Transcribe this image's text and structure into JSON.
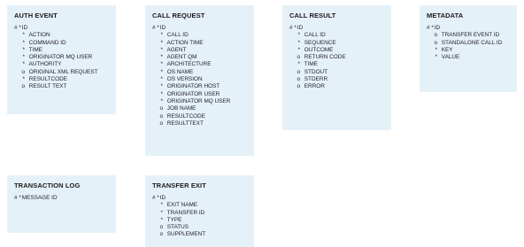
{
  "entities": [
    {
      "key": "auth-event",
      "title": "AUTH EVENT",
      "attributes": [
        {
          "marker": "# *",
          "name": "ID",
          "pk": true
        },
        {
          "marker": "*",
          "name": "ACTION"
        },
        {
          "marker": "*",
          "name": "COMMAND ID"
        },
        {
          "marker": "*",
          "name": "TIME"
        },
        {
          "marker": "*",
          "name": "ORIGINATOR MQ USER"
        },
        {
          "marker": "*",
          "name": "AUTHORITY"
        },
        {
          "marker": "o",
          "name": "ORIGINAL XML REQUEST"
        },
        {
          "marker": "*",
          "name": "RESULTCODE"
        },
        {
          "marker": "o",
          "name": "RESULT TEXT"
        }
      ]
    },
    {
      "key": "call-request",
      "title": "CALL REQUEST",
      "attributes": [
        {
          "marker": "# *",
          "name": "ID",
          "pk": true
        },
        {
          "marker": "*",
          "name": "CALL ID"
        },
        {
          "marker": "*",
          "name": "ACTION TIME"
        },
        {
          "marker": "*",
          "name": "AGENT"
        },
        {
          "marker": "*",
          "name": "AGENT QM"
        },
        {
          "marker": "*",
          "name": "ARCHITECTURE"
        },
        {
          "marker": "*",
          "name": "OS NAME"
        },
        {
          "marker": "*",
          "name": "OS VERSION"
        },
        {
          "marker": "*",
          "name": "ORIGINATOR HOST"
        },
        {
          "marker": "*",
          "name": "ORIGINATOR USER"
        },
        {
          "marker": "*",
          "name": "ORIGINATOR MQ USER"
        },
        {
          "marker": "o",
          "name": "JOB NAME"
        },
        {
          "marker": "o",
          "name": "RESULTCODE"
        },
        {
          "marker": "o",
          "name": "RESULTTEXT"
        }
      ]
    },
    {
      "key": "call-result",
      "title": "CALL RESULT",
      "attributes": [
        {
          "marker": "# *",
          "name": "ID",
          "pk": true
        },
        {
          "marker": "*",
          "name": "CALL ID"
        },
        {
          "marker": "*",
          "name": "SEQUENCE"
        },
        {
          "marker": "*",
          "name": "OUTCOME"
        },
        {
          "marker": "o",
          "name": "RETURN CODE"
        },
        {
          "marker": "*",
          "name": "TIME"
        },
        {
          "marker": "o",
          "name": "STDOUT"
        },
        {
          "marker": "o",
          "name": "STDERR"
        },
        {
          "marker": "o",
          "name": "ERROR"
        }
      ]
    },
    {
      "key": "metadata",
      "title": "METADATA",
      "attributes": [
        {
          "marker": "# *",
          "name": "ID",
          "pk": true
        },
        {
          "marker": "o",
          "name": "TRANSFER EVENT ID"
        },
        {
          "marker": "o",
          "name": "STANDALONE CALL ID"
        },
        {
          "marker": "*",
          "name": "KEY"
        },
        {
          "marker": "*",
          "name": "VALUE"
        }
      ]
    },
    {
      "key": "transaction-log",
      "title": "TRANSACTION LOG",
      "attributes": [
        {
          "marker": "# *",
          "name": "MESSAGE ID",
          "pk": true
        }
      ]
    },
    {
      "key": "transfer-exit",
      "title": "TRANSFER EXIT",
      "attributes": [
        {
          "marker": "# *",
          "name": "ID",
          "pk": true
        },
        {
          "marker": "*",
          "name": "EXIT NAME"
        },
        {
          "marker": "*",
          "name": "TRANSFER ID"
        },
        {
          "marker": "*",
          "name": "TYPE"
        },
        {
          "marker": "o",
          "name": "STATUS"
        },
        {
          "marker": "o",
          "name": "SUPPLEMENT"
        }
      ]
    }
  ]
}
